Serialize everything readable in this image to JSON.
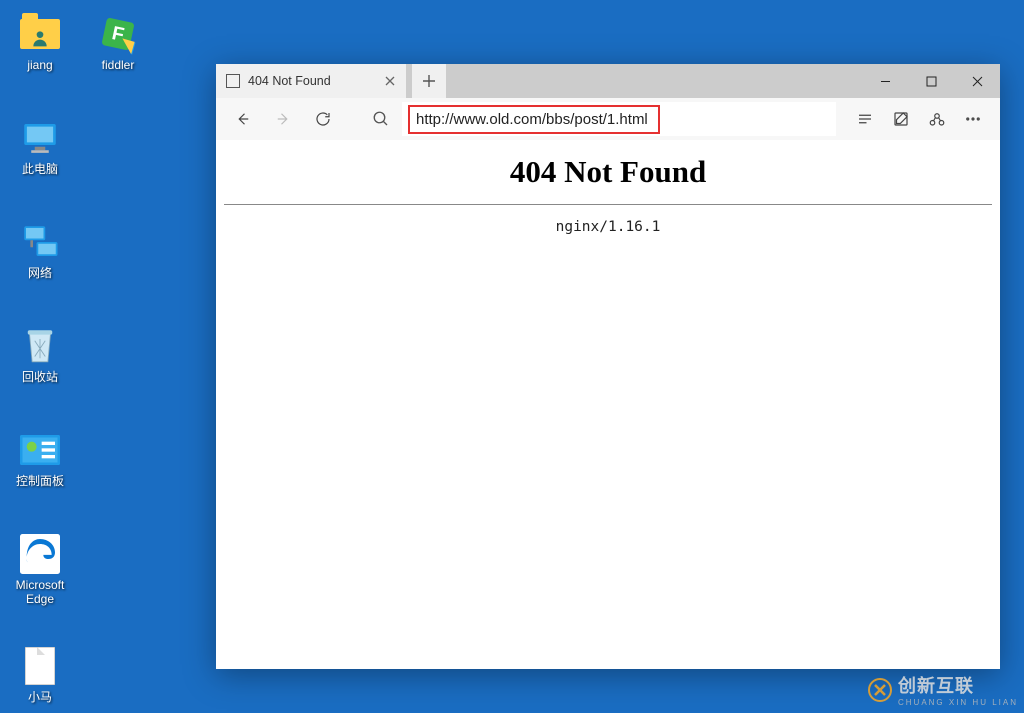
{
  "desktop": {
    "icons": [
      {
        "label": "jiang"
      },
      {
        "label": "fiddler"
      },
      {
        "label": "此电脑"
      },
      {
        "label": "网络"
      },
      {
        "label": "回收站"
      },
      {
        "label": "控制面板"
      },
      {
        "label": "Microsoft Edge"
      },
      {
        "label": "小马"
      }
    ]
  },
  "browser": {
    "tab_title": "404 Not Found",
    "url": "http://www.old.com/bbs/post/1.html",
    "page": {
      "heading": "404 Not Found",
      "server": "nginx/1.16.1"
    }
  },
  "watermark": {
    "main": "创新互联",
    "sub": "CHUANG XIN HU LIAN"
  }
}
